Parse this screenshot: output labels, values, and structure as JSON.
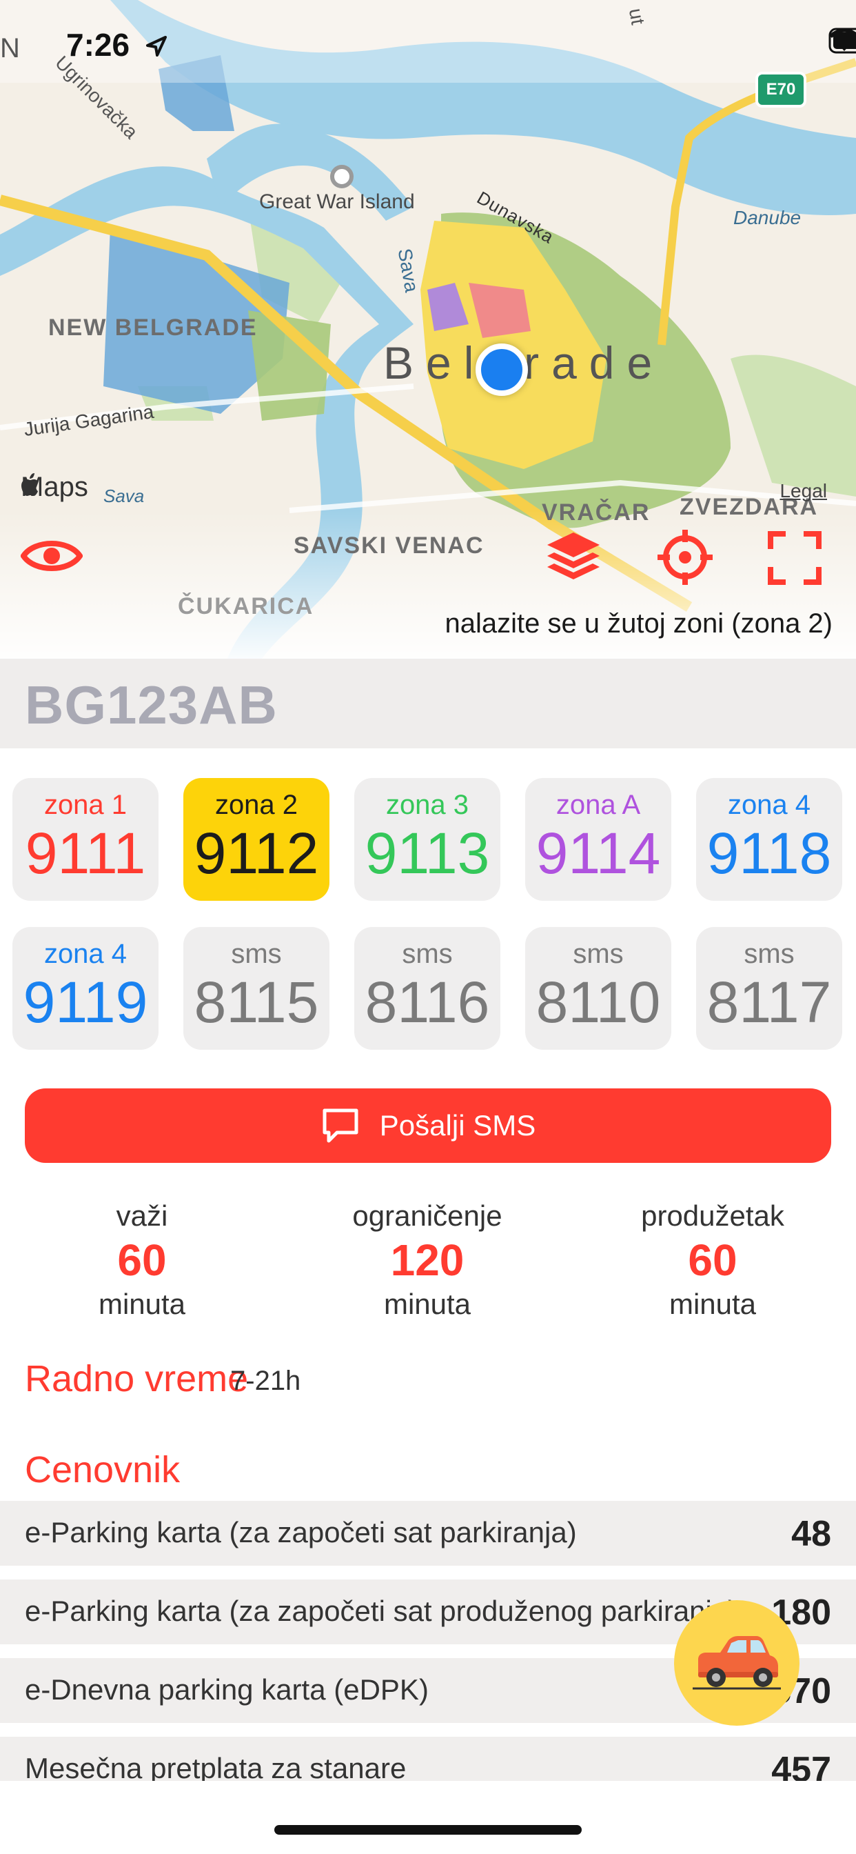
{
  "status_bar": {
    "time": "7:26",
    "location_icon": "location-arrow-icon",
    "signal_icon": "signal-icon",
    "wifi_icon": "wifi-icon",
    "battery_icon": "battery-icon"
  },
  "map": {
    "labels": {
      "great_war_island": "Great War Island",
      "new_belgrade": "NEW BELGRADE",
      "belgrade": "Belgrade",
      "dunavska": "Dunavska",
      "danube": "Danube",
      "sava": "Sava",
      "sava2": "Sava",
      "jurija": "Jurija Gagarina",
      "vracar": "VRAČAR",
      "zvezdara": "ZVEZDARA",
      "savski_venac": "SAVSKI VENAC",
      "cukarica": "ČUKARICA",
      "highway_shield": "E70",
      "legal": "Legal",
      "maps_brand": "Maps",
      "top_left_fragment": "N",
      "top_left_road": "Ugrinovačka",
      "top_right_road": "ut"
    },
    "zone_hint": "nalazite se u žutoj zoni (zona 2)",
    "buttons": {
      "eye": "eye-icon",
      "layers": "layers-icon",
      "locate": "crosshair-icon",
      "expand": "expand-icon"
    },
    "colors": {
      "water": "#9fd0e8",
      "land": "#f4efe6",
      "zone_yellow": "#f7dc5c",
      "zone_green": "#a9c97a",
      "zone_red": "#f08a8a",
      "zone_purple": "#b08ad9",
      "zone_blue": "#6aa8d8",
      "location_dot": "#1a7ff0"
    }
  },
  "plate": {
    "number": "BG123AB"
  },
  "zones": [
    {
      "label": "zona 1",
      "number": "9111",
      "color": "#ff3b30",
      "bg": "#efeeee"
    },
    {
      "label": "zona 2",
      "number": "9112",
      "color": "#1c1c1c",
      "bg": "#fdd30a"
    },
    {
      "label": "zona 3",
      "number": "9113",
      "color": "#34c759",
      "bg": "#efeeee"
    },
    {
      "label": "zona A",
      "number": "9114",
      "color": "#af52de",
      "bg": "#efeeee"
    },
    {
      "label": "zona 4",
      "number": "9118",
      "color": "#1a82f0",
      "bg": "#efeeee"
    },
    {
      "label": "zona 4",
      "number": "9119",
      "color": "#1a82f0",
      "bg": "#efeeee"
    },
    {
      "label": "sms",
      "number": "8115",
      "color": "#7a7a7a",
      "bg": "#efeeee"
    },
    {
      "label": "sms",
      "number": "8116",
      "color": "#7a7a7a",
      "bg": "#efeeee"
    },
    {
      "label": "sms",
      "number": "8110",
      "color": "#7a7a7a",
      "bg": "#efeeee"
    },
    {
      "label": "sms",
      "number": "8117",
      "color": "#7a7a7a",
      "bg": "#efeeee"
    }
  ],
  "send_button": {
    "label": "Pošalji SMS",
    "icon": "message-icon"
  },
  "stats": [
    {
      "title": "važi",
      "value": "60",
      "unit": "minuta"
    },
    {
      "title": "ograničenje",
      "value": "120",
      "unit": "minuta"
    },
    {
      "title": "produžetak",
      "value": "60",
      "unit": "minuta"
    }
  ],
  "working_hours": {
    "title": "Radno vreme",
    "value": "7-21h"
  },
  "pricelist": {
    "title": "Cenovnik",
    "rows": [
      {
        "label": "e-Parking karta (za započeti sat parkiranja)",
        "value": "48"
      },
      {
        "label": "e-Parking karta (za započeti sat produženog parkiranja)",
        "value": "180"
      },
      {
        "label": "e-Dnevna parking karta (eDPK)",
        "value": "570"
      },
      {
        "label": "Mesečna pretplata za stanare",
        "value": "457"
      }
    ]
  },
  "fab": {
    "icon": "car-icon"
  }
}
